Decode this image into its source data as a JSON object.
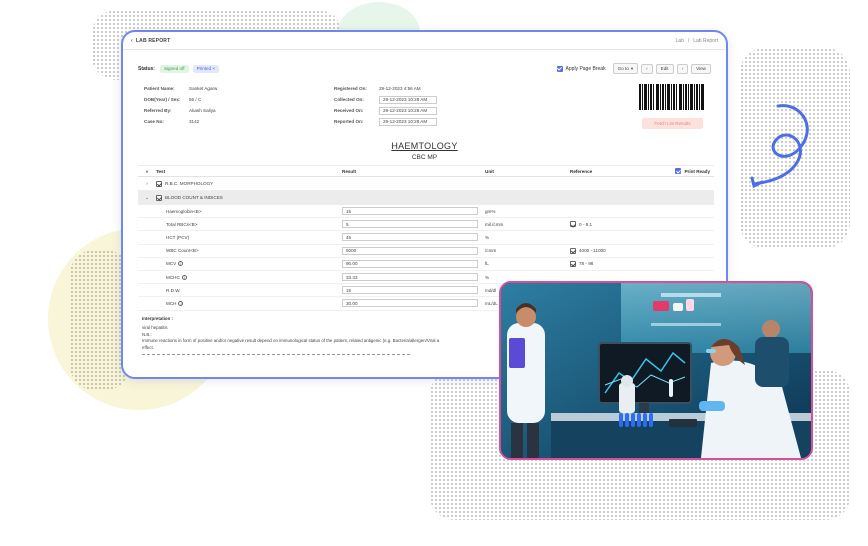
{
  "window": {
    "title": "LAB REPORT",
    "breadcrumb": [
      "Lab",
      "/",
      "Lab Report"
    ]
  },
  "status": {
    "label": "Status:",
    "tags": [
      "Signed off",
      "Printed"
    ],
    "apply_page_break": "Apply Page Break",
    "goto": "Go to",
    "edit": "Edit",
    "view": "View"
  },
  "patient": {
    "name_label": "Patient Name:",
    "name": "Sanket Agarw",
    "dob_label": "DOB(Year) / Sex:",
    "dob": "56 / C",
    "ref_label": "Referred By:",
    "ref": "Akash Saliya",
    "case_label": "Case No:",
    "case": "3142",
    "registered_label": "Registered On:",
    "registered": "29-12-2023 4:56 AM",
    "collected_label": "Collected On:",
    "collected": "29-12-2023 10:28 AM",
    "received_label": "Received On:",
    "received": "29-12-2023 10:28 AM",
    "reported_label": "Reported On:",
    "reported": "29-12-2023 10:28 AM"
  },
  "fetch_button": "Fetch LIS Results",
  "section": {
    "title": "HAEMTOLOGY",
    "subtitle": "CBC MP"
  },
  "table": {
    "headers": {
      "test": "Test",
      "result": "Result",
      "unit": "Unit",
      "reference": "Reference",
      "print_ready": "Print Ready"
    },
    "groups": [
      "R.B.C. MORPHOLOGY",
      "BLOOD COUNT & INDICES"
    ],
    "rows": [
      {
        "test": "Haemoglobin<B>",
        "result": "15",
        "unit": "gm%",
        "ref": ""
      },
      {
        "test": "Total RBCs<B>",
        "result": "5",
        "unit": "mil./cmm",
        "ref": "0 - 6.1"
      },
      {
        "test": "HCT (PCV)",
        "result": "45",
        "unit": "%",
        "ref": ""
      },
      {
        "test": "WBC Count<B>",
        "result": "5000",
        "unit": "/cmm",
        "ref": "4000 - 11000"
      },
      {
        "test": "MCV",
        "result": "90.00",
        "unit": "fL",
        "ref": "78 - 98"
      },
      {
        "test": "MCHC",
        "result": "33.33",
        "unit": "%",
        "ref": ""
      },
      {
        "test": "R.D.W.",
        "result": "15",
        "unit": "md/dl",
        "ref": ""
      },
      {
        "test": "MCH",
        "result": "30.00",
        "unit": "mL/dL",
        "ref": ""
      }
    ]
  },
  "interpretation": {
    "heading": "Interpretation :",
    "line1": "viral hepatitis",
    "line2": "N.B.:",
    "line3": "Immune reactions in form of positive and/or negative result depend on immunological status of the patient, related antigenic (e.g. Bacteria/allergen/Viral a",
    "line4": "effect."
  },
  "colors": {
    "accent": "#5b6fe0",
    "window_border": "#6f88ef",
    "photo_border": "#d64f9a",
    "signed_tag": "#3d9b4d"
  }
}
